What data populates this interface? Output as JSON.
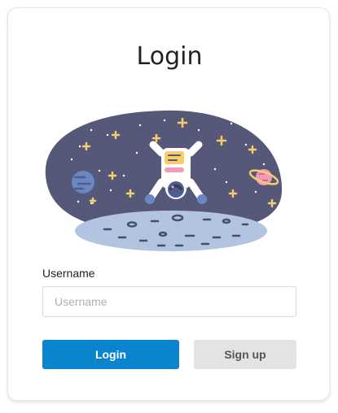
{
  "login_card": {
    "title": "Login",
    "illustration": "astronaut-in-space-illustration",
    "username_label": "Username",
    "username_value": "",
    "username_placeholder": "Username",
    "login_button_label": "Login",
    "signup_button_label": "Sign up"
  },
  "colors": {
    "primary": "#0a84cf",
    "secondary_button": "#e2e3e5",
    "space_background": "#565879",
    "moon_surface": "#b3c4e3",
    "star": "#f7cd6a"
  }
}
